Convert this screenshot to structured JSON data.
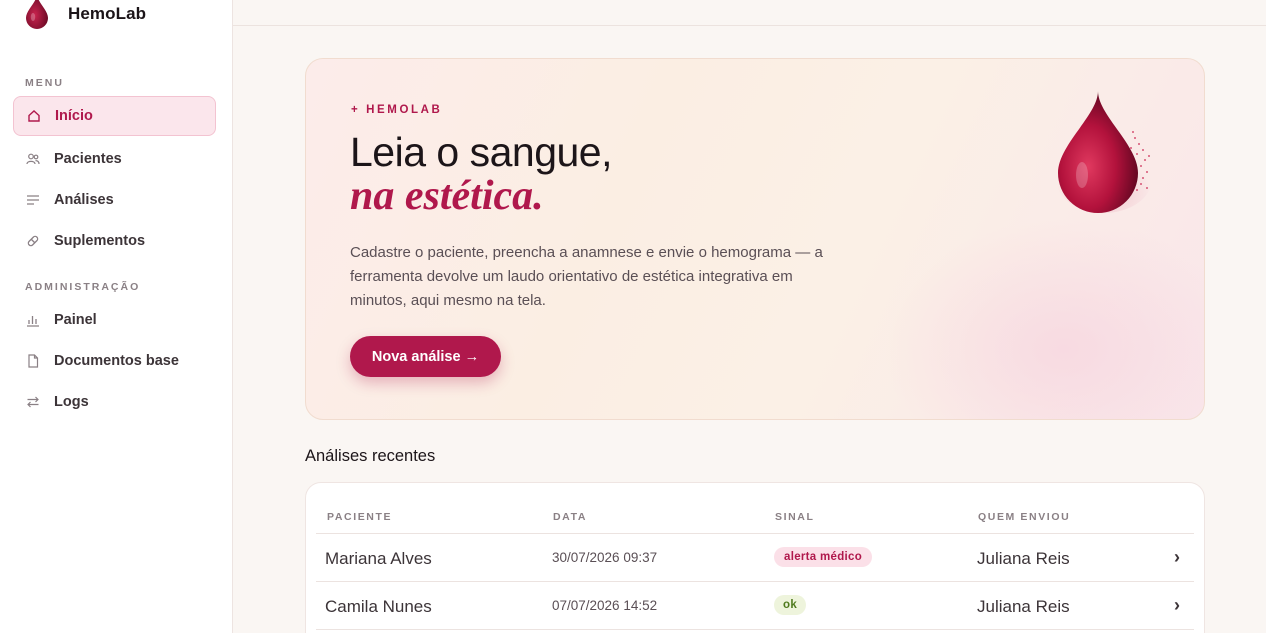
{
  "app": {
    "name": "HemoLab"
  },
  "sidebar": {
    "menu_label": "MENU",
    "admin_label": "ADMINISTRAÇÃO",
    "items": [
      {
        "label": "Início",
        "icon": "home-icon",
        "active": true
      },
      {
        "label": "Pacientes",
        "icon": "users-icon"
      },
      {
        "label": "Análises",
        "icon": "list-icon"
      },
      {
        "label": "Suplementos",
        "icon": "pill-icon"
      }
    ],
    "admin_items": [
      {
        "label": "Painel",
        "icon": "bar-chart-icon"
      },
      {
        "label": "Documentos base",
        "icon": "document-icon"
      },
      {
        "label": "Logs",
        "icon": "swap-icon"
      }
    ]
  },
  "hero": {
    "eyebrow": "+ HEMOLAB",
    "title_line1": "Leia o sangue,",
    "title_line2": "na estética.",
    "description": "Cadastre o paciente, preencha a anamnese e envie o hemograma — a ferramenta devolve um laudo orientativo de estética integrativa em minutos, aqui mesmo na tela.",
    "cta_label": "Nova análise →"
  },
  "recent": {
    "title": "Análises recentes",
    "columns": [
      "PACIENTE",
      "DATA",
      "SINAL",
      "QUEM ENVIOU"
    ],
    "rows": [
      {
        "paciente": "Mariana Alves",
        "data": "30/07/2026 09:37",
        "sinal": "alerta médico",
        "sinal_type": "alert",
        "enviou": "Juliana Reis",
        "arrow": "›"
      },
      {
        "paciente": "Camila Nunes",
        "data": "07/07/2026 14:52",
        "sinal": "ok",
        "sinal_type": "ok",
        "enviou": "Juliana Reis",
        "arrow": "›"
      }
    ]
  },
  "colors": {
    "accent": "#b0184c",
    "accent_soft": "#fbe6ec",
    "ok_bg": "#eef4dc",
    "ok_text": "#4f7a1d"
  }
}
